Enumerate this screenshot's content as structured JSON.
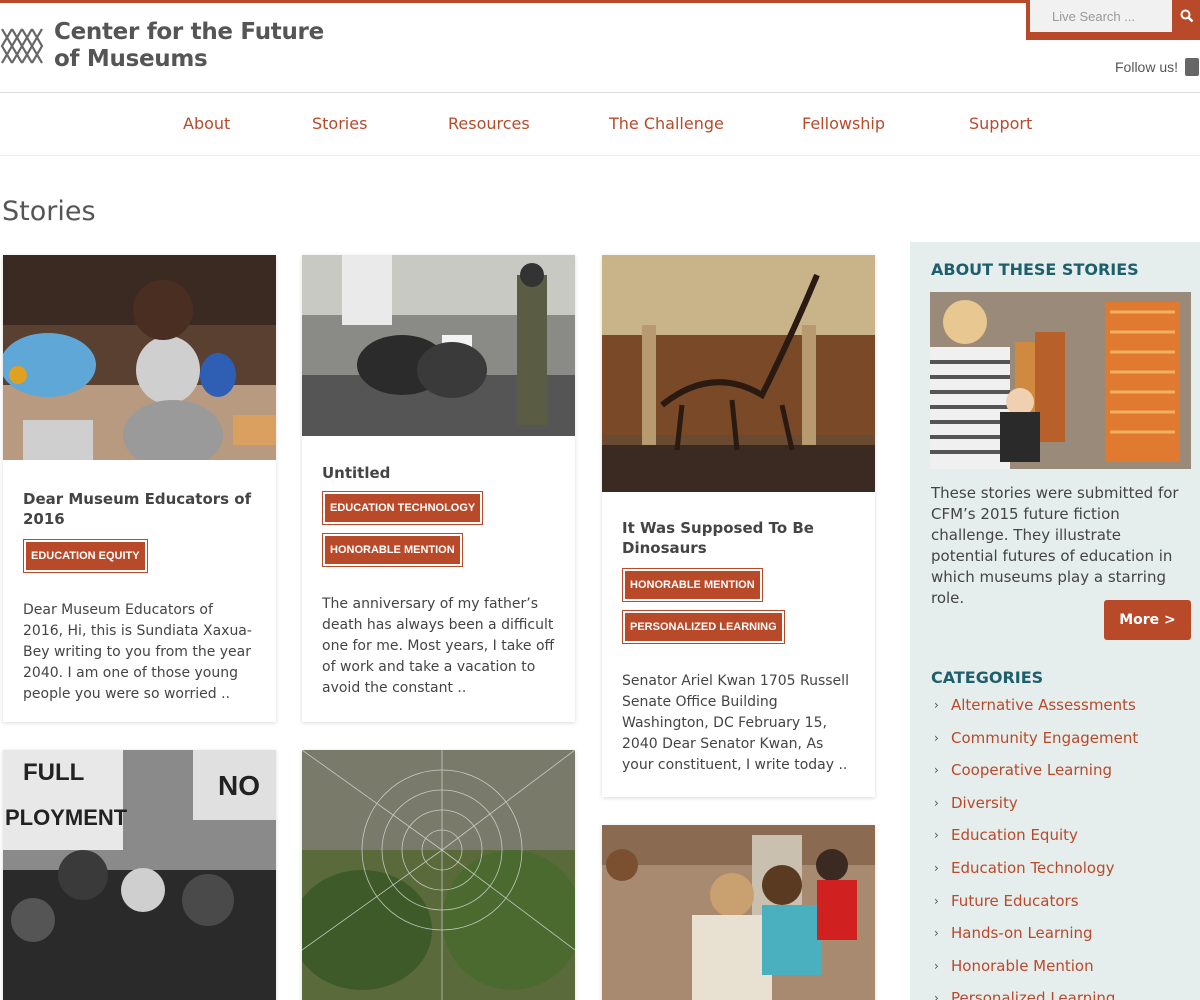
{
  "site": {
    "logo_line1": "Center for the Future",
    "logo_line2": "of Museums",
    "search_placeholder": "Live Search ...",
    "follow_text": "Follow us!"
  },
  "nav": {
    "items": [
      {
        "label": "About"
      },
      {
        "label": "Stories"
      },
      {
        "label": "Resources"
      },
      {
        "label": "The Challenge"
      },
      {
        "label": "Fellowship"
      },
      {
        "label": "Support"
      }
    ]
  },
  "page": {
    "title": "Stories"
  },
  "stories": [
    {
      "title": "Dear Museum Educators of 2016",
      "tags": [
        "EDUCATION EQUITY"
      ],
      "excerpt": "Dear Museum Educators of 2016, Hi, this is Sundiata Xaxua-Bey writing to you from the year 2040. I am one of those young people you were so worried .."
    },
    {
      "title": "Untitled",
      "tags": [
        "EDUCATION TECHNOLOGY",
        "HONORABLE MENTION"
      ],
      "excerpt": "The anniversary of my father’s death has always been a difficult one for me. Most years, I take off of work and take a vacation to avoid the constant .."
    },
    {
      "title": "It Was Supposed To Be Dinosaurs",
      "tags": [
        "HONORABLE MENTION",
        "PERSONALIZED LEARNING"
      ],
      "excerpt": "Senator Ariel Kwan 1705 Russell Senate Office Building Washington, DC February 15, 2040 Dear Senator Kwan, As your constituent, I write today .."
    }
  ],
  "sidebar": {
    "about_heading": "ABOUT THESE STORIES",
    "about_text": "These stories were submitted for CFM’s 2015 future fiction challenge. They illustrate potential futures of education in which museums play a starring role.",
    "more_label": "More >",
    "categories_heading": "CATEGORIES",
    "categories": [
      "Alternative Assessments",
      "Community Engagement",
      "Cooperative Learning",
      "Diversity",
      "Education Equity",
      "Education Technology",
      "Future Educators",
      "Hands-on Learning",
      "Honorable Mention",
      "Personalized Learning"
    ]
  },
  "colors": {
    "accent": "#b84a2a",
    "heading_teal": "#1e5f6c",
    "sidebar_bg": "#e6eded"
  },
  "icons": {
    "logo": "museum-lattice-logo",
    "search": "search-icon",
    "twitter": "twitter-icon",
    "chevron": "chevron-right-icon"
  }
}
